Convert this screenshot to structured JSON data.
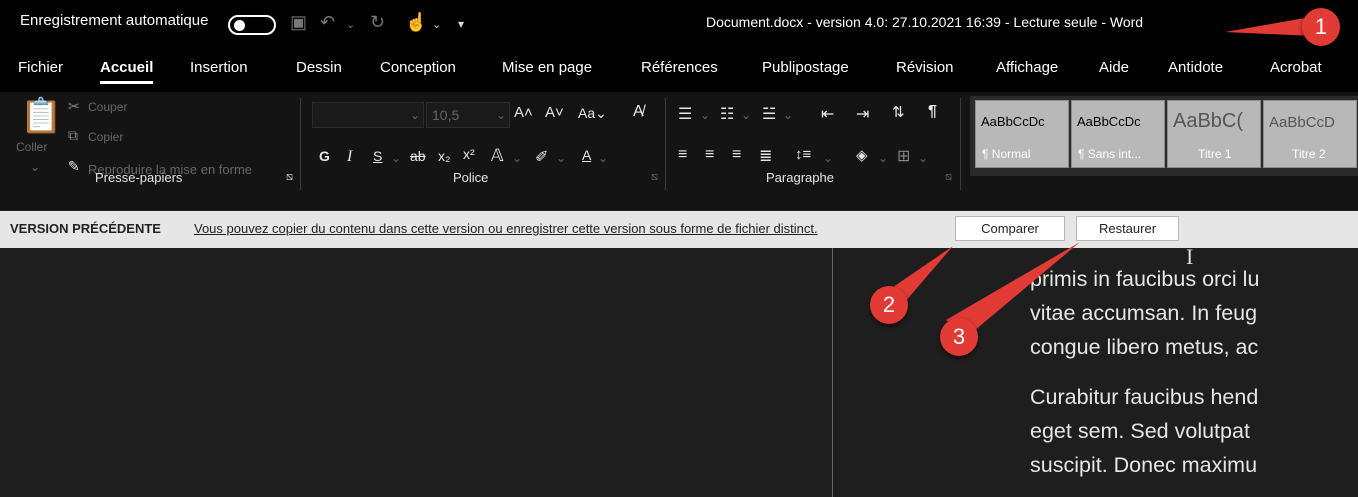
{
  "titlebar": {
    "autosave_label": "Enregistrement automatique",
    "document_title": "Document.docx  -  version 4.0: 27.10.2021 16:39  -  Lecture seule  -  Word"
  },
  "menu": {
    "tabs": [
      "Fichier",
      "Accueil",
      "Insertion",
      "Dessin",
      "Conception",
      "Mise en page",
      "Références",
      "Publipostage",
      "Révision",
      "Affichage",
      "Aide",
      "Antidote",
      "Acrobat"
    ],
    "active_tab": "Accueil"
  },
  "ribbon": {
    "clipboard": {
      "paste": "Coller",
      "cut": "Couper",
      "copy": "Copier",
      "format_painter": "Reproduire la mise en forme",
      "group": "Presse-papiers"
    },
    "font": {
      "size": "10,5",
      "bold": "G",
      "italic": "I",
      "underline": "S",
      "group": "Police"
    },
    "paragraph": {
      "group": "Paragraphe"
    },
    "styles": [
      {
        "sample": "AaBbCcDc",
        "name": "¶ Normal"
      },
      {
        "sample": "AaBbCcDc",
        "name": "¶ Sans int..."
      },
      {
        "sample": "AaBbC(",
        "name": "Titre 1"
      },
      {
        "sample": "AaBbCcD",
        "name": "Titre 2"
      }
    ]
  },
  "version_bar": {
    "title": "VERSION PRÉCÉDENTE",
    "message": "Vous pouvez copier du contenu dans cette version ou enregistrer cette version sous forme de fichier distinct.",
    "compare_button": "Comparer",
    "restore_button": "Restaurer"
  },
  "document": {
    "paragraph1": [
      "primis in faucibus orci lu",
      "vitae accumsan. In feug",
      "congue libero metus, ac"
    ],
    "paragraph2": [
      "Curabitur faucibus hend",
      "eget sem. Sed volutpat",
      "suscipit. Donec maximu"
    ]
  },
  "callouts": [
    "1",
    "2",
    "3"
  ],
  "colors": {
    "callout": "#e23a34",
    "accent_bar": "#e6e6e6"
  }
}
